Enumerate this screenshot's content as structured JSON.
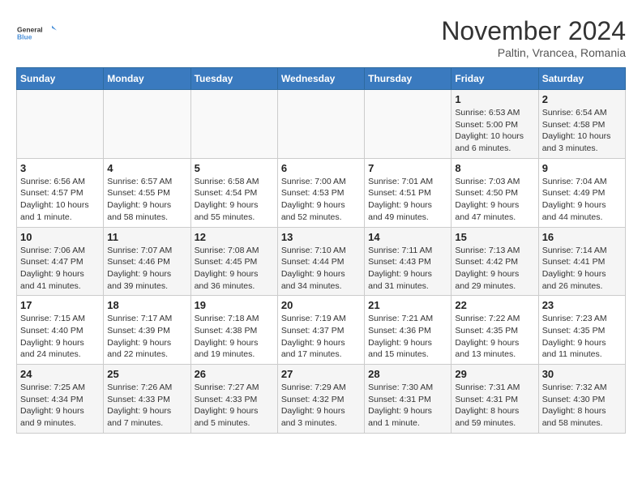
{
  "logo": {
    "line1": "General",
    "line2": "Blue"
  },
  "title": "November 2024",
  "location": "Paltin, Vrancea, Romania",
  "weekdays": [
    "Sunday",
    "Monday",
    "Tuesday",
    "Wednesday",
    "Thursday",
    "Friday",
    "Saturday"
  ],
  "weeks": [
    [
      {
        "day": "",
        "info": ""
      },
      {
        "day": "",
        "info": ""
      },
      {
        "day": "",
        "info": ""
      },
      {
        "day": "",
        "info": ""
      },
      {
        "day": "",
        "info": ""
      },
      {
        "day": "1",
        "info": "Sunrise: 6:53 AM\nSunset: 5:00 PM\nDaylight: 10 hours and 6 minutes."
      },
      {
        "day": "2",
        "info": "Sunrise: 6:54 AM\nSunset: 4:58 PM\nDaylight: 10 hours and 3 minutes."
      }
    ],
    [
      {
        "day": "3",
        "info": "Sunrise: 6:56 AM\nSunset: 4:57 PM\nDaylight: 10 hours and 1 minute."
      },
      {
        "day": "4",
        "info": "Sunrise: 6:57 AM\nSunset: 4:55 PM\nDaylight: 9 hours and 58 minutes."
      },
      {
        "day": "5",
        "info": "Sunrise: 6:58 AM\nSunset: 4:54 PM\nDaylight: 9 hours and 55 minutes."
      },
      {
        "day": "6",
        "info": "Sunrise: 7:00 AM\nSunset: 4:53 PM\nDaylight: 9 hours and 52 minutes."
      },
      {
        "day": "7",
        "info": "Sunrise: 7:01 AM\nSunset: 4:51 PM\nDaylight: 9 hours and 49 minutes."
      },
      {
        "day": "8",
        "info": "Sunrise: 7:03 AM\nSunset: 4:50 PM\nDaylight: 9 hours and 47 minutes."
      },
      {
        "day": "9",
        "info": "Sunrise: 7:04 AM\nSunset: 4:49 PM\nDaylight: 9 hours and 44 minutes."
      }
    ],
    [
      {
        "day": "10",
        "info": "Sunrise: 7:06 AM\nSunset: 4:47 PM\nDaylight: 9 hours and 41 minutes."
      },
      {
        "day": "11",
        "info": "Sunrise: 7:07 AM\nSunset: 4:46 PM\nDaylight: 9 hours and 39 minutes."
      },
      {
        "day": "12",
        "info": "Sunrise: 7:08 AM\nSunset: 4:45 PM\nDaylight: 9 hours and 36 minutes."
      },
      {
        "day": "13",
        "info": "Sunrise: 7:10 AM\nSunset: 4:44 PM\nDaylight: 9 hours and 34 minutes."
      },
      {
        "day": "14",
        "info": "Sunrise: 7:11 AM\nSunset: 4:43 PM\nDaylight: 9 hours and 31 minutes."
      },
      {
        "day": "15",
        "info": "Sunrise: 7:13 AM\nSunset: 4:42 PM\nDaylight: 9 hours and 29 minutes."
      },
      {
        "day": "16",
        "info": "Sunrise: 7:14 AM\nSunset: 4:41 PM\nDaylight: 9 hours and 26 minutes."
      }
    ],
    [
      {
        "day": "17",
        "info": "Sunrise: 7:15 AM\nSunset: 4:40 PM\nDaylight: 9 hours and 24 minutes."
      },
      {
        "day": "18",
        "info": "Sunrise: 7:17 AM\nSunset: 4:39 PM\nDaylight: 9 hours and 22 minutes."
      },
      {
        "day": "19",
        "info": "Sunrise: 7:18 AM\nSunset: 4:38 PM\nDaylight: 9 hours and 19 minutes."
      },
      {
        "day": "20",
        "info": "Sunrise: 7:19 AM\nSunset: 4:37 PM\nDaylight: 9 hours and 17 minutes."
      },
      {
        "day": "21",
        "info": "Sunrise: 7:21 AM\nSunset: 4:36 PM\nDaylight: 9 hours and 15 minutes."
      },
      {
        "day": "22",
        "info": "Sunrise: 7:22 AM\nSunset: 4:35 PM\nDaylight: 9 hours and 13 minutes."
      },
      {
        "day": "23",
        "info": "Sunrise: 7:23 AM\nSunset: 4:35 PM\nDaylight: 9 hours and 11 minutes."
      }
    ],
    [
      {
        "day": "24",
        "info": "Sunrise: 7:25 AM\nSunset: 4:34 PM\nDaylight: 9 hours and 9 minutes."
      },
      {
        "day": "25",
        "info": "Sunrise: 7:26 AM\nSunset: 4:33 PM\nDaylight: 9 hours and 7 minutes."
      },
      {
        "day": "26",
        "info": "Sunrise: 7:27 AM\nSunset: 4:33 PM\nDaylight: 9 hours and 5 minutes."
      },
      {
        "day": "27",
        "info": "Sunrise: 7:29 AM\nSunset: 4:32 PM\nDaylight: 9 hours and 3 minutes."
      },
      {
        "day": "28",
        "info": "Sunrise: 7:30 AM\nSunset: 4:31 PM\nDaylight: 9 hours and 1 minute."
      },
      {
        "day": "29",
        "info": "Sunrise: 7:31 AM\nSunset: 4:31 PM\nDaylight: 8 hours and 59 minutes."
      },
      {
        "day": "30",
        "info": "Sunrise: 7:32 AM\nSunset: 4:30 PM\nDaylight: 8 hours and 58 minutes."
      }
    ]
  ]
}
